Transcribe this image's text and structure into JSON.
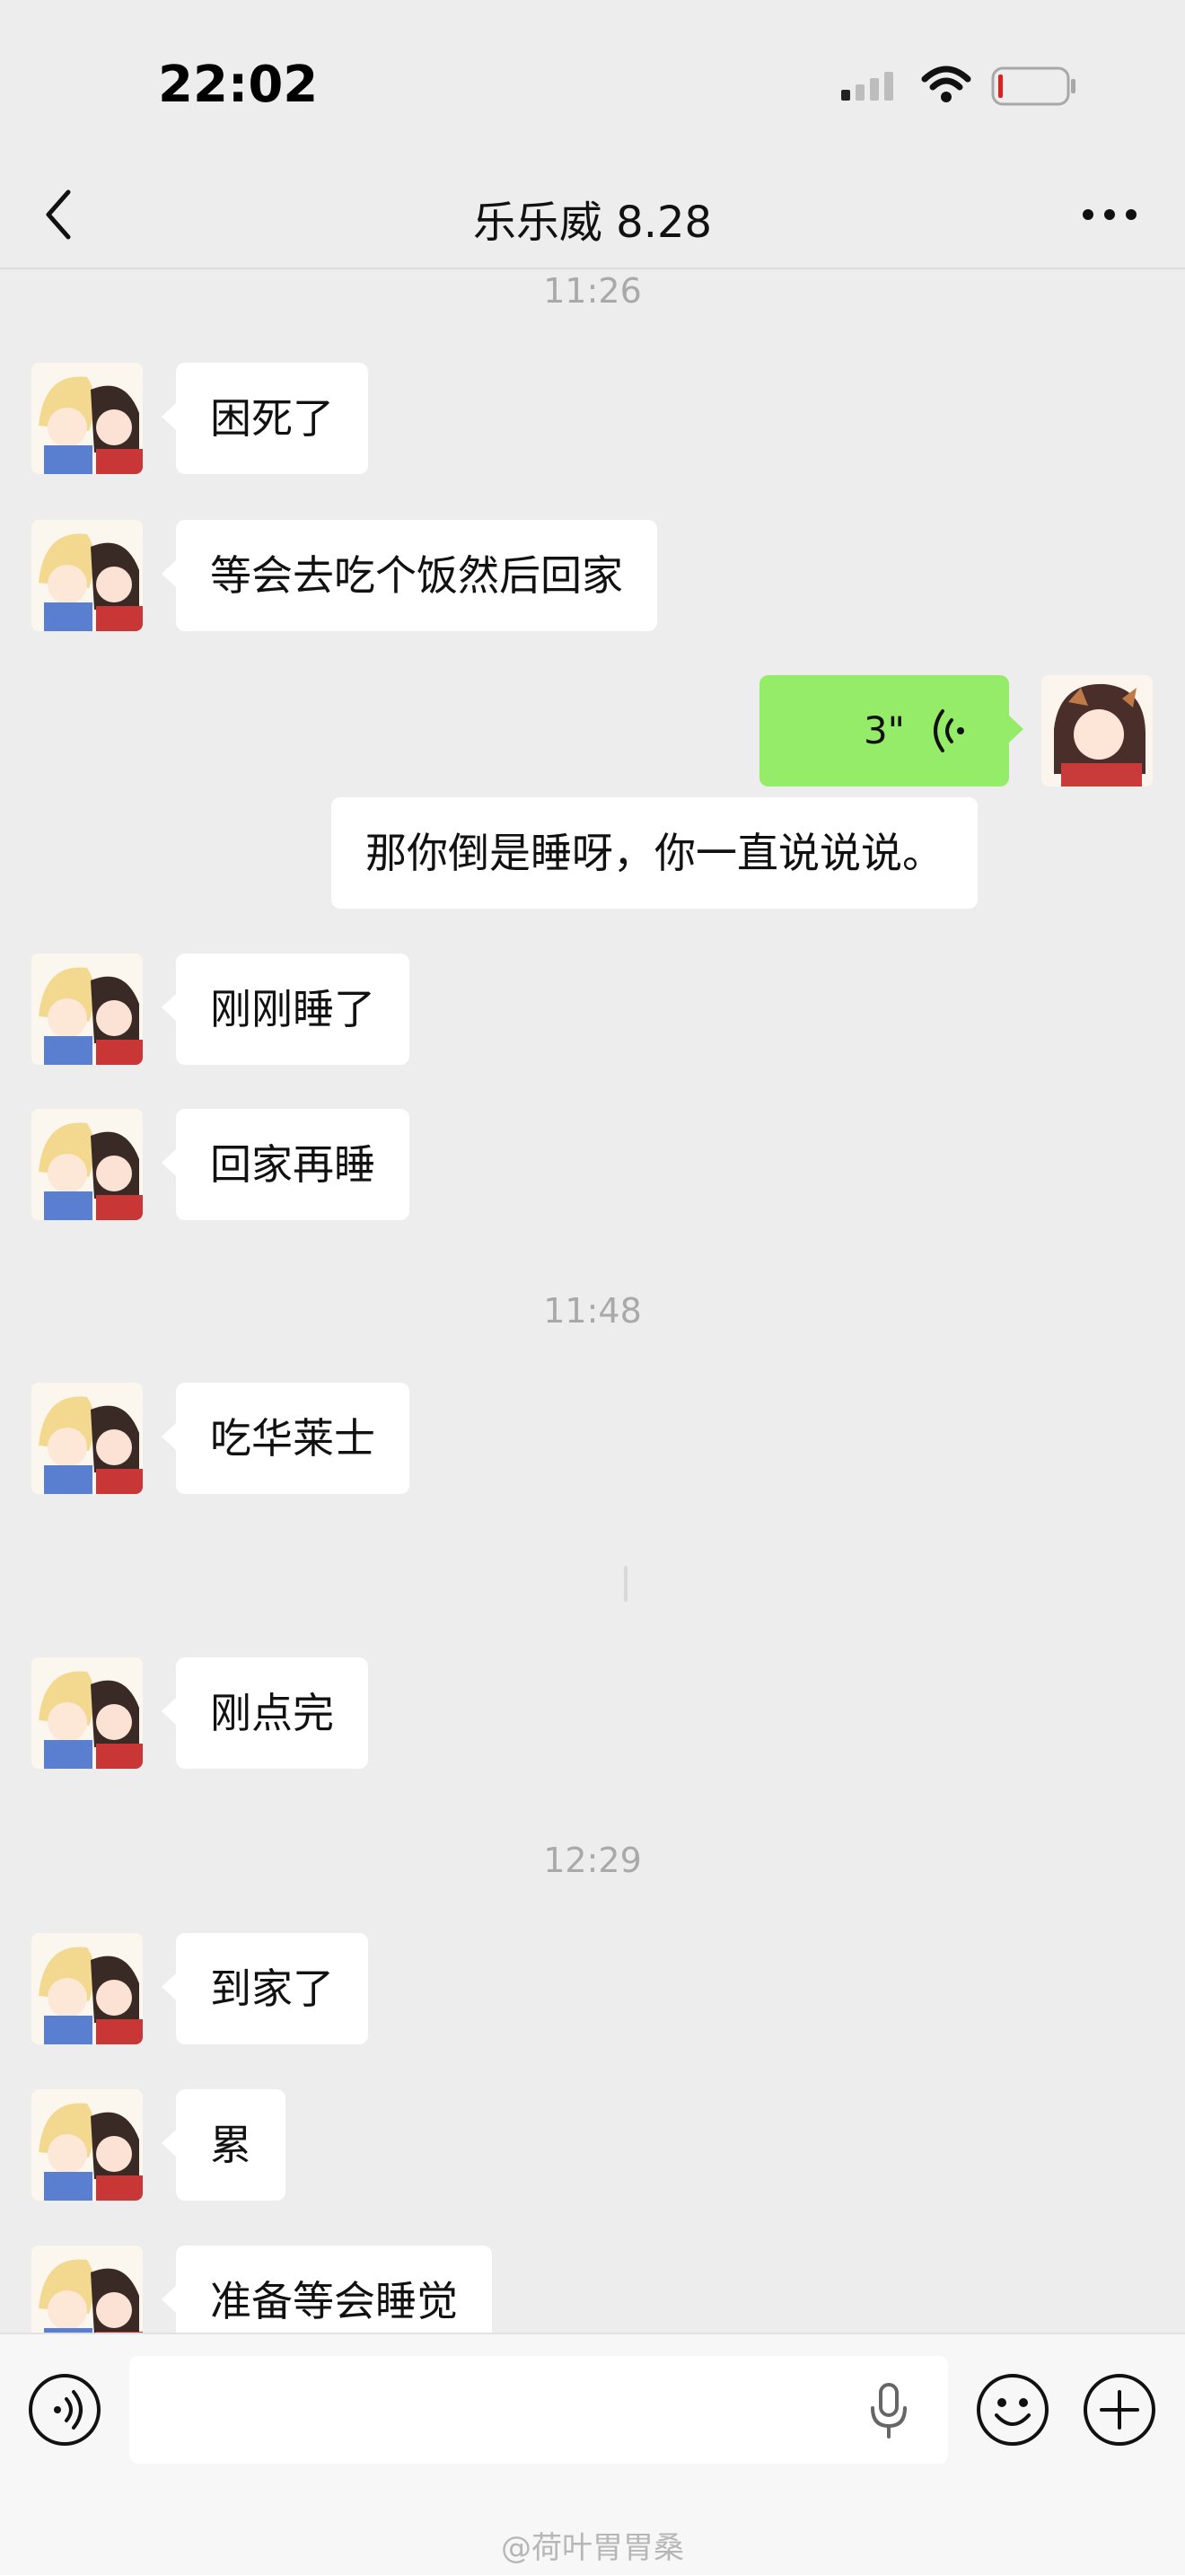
{
  "status_bar": {
    "time": "22:02"
  },
  "header": {
    "title": "乐乐威 8.28"
  },
  "times": [
    "11:26",
    "11:48",
    "12:29"
  ],
  "messages": {
    "m1": "困死了",
    "m2": "等会去吃个饭然后回家",
    "voice_duration": "3\"",
    "m3": "那你倒是睡呀，你一直说说说。",
    "m4": "刚刚睡了",
    "m5": "回家再睡",
    "m6": "吃华莱士",
    "m7": "刚点完",
    "m8": "到家了",
    "m9": "累",
    "m10": "准备等会睡觉"
  },
  "footer": {
    "watermark": "@荷叶胃胃桑"
  },
  "icons": {
    "back": "chevron-left-icon",
    "more": "more-dots-icon",
    "voice_toggle": "voice-mode-icon",
    "mic": "microphone-icon",
    "emoji": "emoji-icon",
    "plus": "plus-icon"
  },
  "colors": {
    "sent_bubble": "#95ec69",
    "background": "#ededed"
  }
}
